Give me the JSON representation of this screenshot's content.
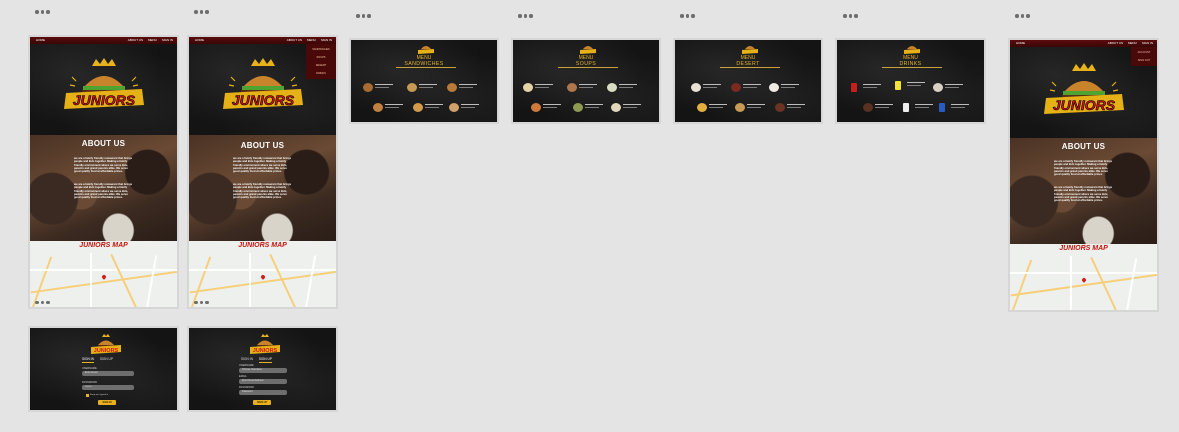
{
  "canvas": {
    "background": "#e4e4e4"
  },
  "artboard_menu_icon": "more-dots-icon",
  "site": {
    "nav_home": "HOME",
    "nav_about": "ABOUT US",
    "nav_menu": "MENU",
    "nav_signin": "SIGN IN",
    "brand": "JUNIORS",
    "about_title": "ABOUT US",
    "about_p1": "we are a family friendly restaurant that brings people and kids together. Making a family friendly environment where we serve kids, parents and grand parents alike. We serve good quality food at affordable prices.",
    "about_p2": "we are a family friendly restaurant that brings people and kids together. Making a family friendly environment where we serve kids, parents and grand parents alike. We serve good quality food at affordable prices.",
    "map_title": "JUNIORS MAP"
  },
  "dropdown_items": [
    "SANDWICHES",
    "SOUPS",
    "DESERT",
    "DRINKS"
  ],
  "dropdown_right_items": [
    "ACCOUNT",
    "SIGN OUT"
  ],
  "menus": [
    {
      "word": "MENU",
      "category": "SANDWICHES"
    },
    {
      "word": "MENU",
      "category": "SOUPS"
    },
    {
      "word": "MENU",
      "category": "DESERT"
    },
    {
      "word": "MENU",
      "category": "DRINKS"
    }
  ],
  "login": {
    "tab_signin": "SIGN IN",
    "tab_signup": "SIGN UP",
    "username_label": "USERNAME",
    "username_value": "Enter Email",
    "password_label": "PASSWORD",
    "password_value": "••••••••",
    "remember": "Keep me signed in",
    "button": "SIGN IN"
  },
  "signup": {
    "tab_signin": "SIGN IN",
    "tab_signup": "SIGN UP",
    "username_label": "USERNAME",
    "username_value": "Choose Username",
    "email_label": "EMAIL",
    "email_value": "Enter Email Address",
    "password_label": "PASSWORD",
    "password_value": "Password",
    "button": "SIGN UP"
  },
  "colors": {
    "accent_gold": "#e6b326",
    "nav_red": "#5a0c0c",
    "map_title_red": "#c4170f"
  }
}
